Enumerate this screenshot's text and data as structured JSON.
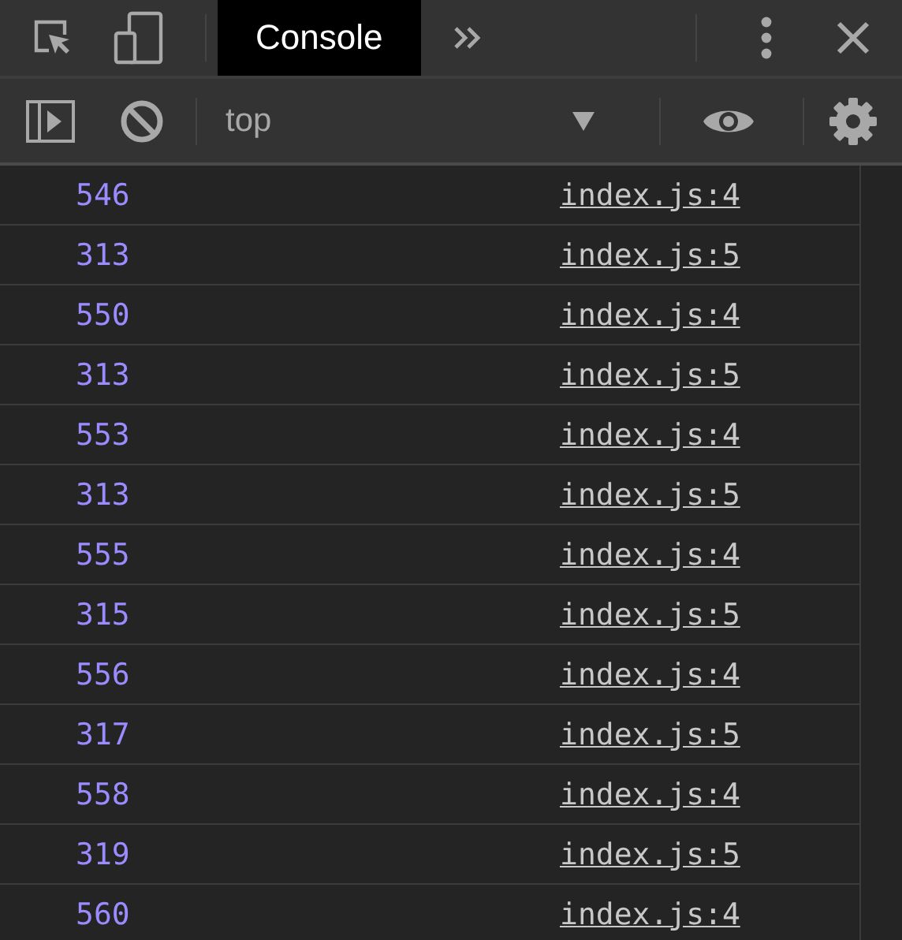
{
  "tabs": [
    {
      "label": "Console",
      "selected": true
    }
  ],
  "context": {
    "value": "top"
  },
  "messages": [
    {
      "value": "546",
      "source": "index.js:4"
    },
    {
      "value": "313",
      "source": "index.js:5"
    },
    {
      "value": "550",
      "source": "index.js:4"
    },
    {
      "value": "313",
      "source": "index.js:5"
    },
    {
      "value": "553",
      "source": "index.js:4"
    },
    {
      "value": "313",
      "source": "index.js:5"
    },
    {
      "value": "555",
      "source": "index.js:4"
    },
    {
      "value": "315",
      "source": "index.js:5"
    },
    {
      "value": "556",
      "source": "index.js:4"
    },
    {
      "value": "317",
      "source": "index.js:5"
    },
    {
      "value": "558",
      "source": "index.js:4"
    },
    {
      "value": "319",
      "source": "index.js:5"
    },
    {
      "value": "560",
      "source": "index.js:4"
    }
  ]
}
